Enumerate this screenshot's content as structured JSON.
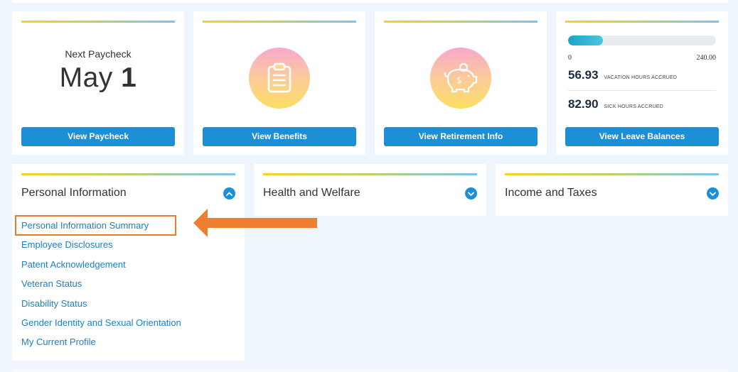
{
  "cards": {
    "paycheck": {
      "label": "Next Paycheck",
      "month": "May",
      "day": "1",
      "button": "View Paycheck"
    },
    "benefits": {
      "icon": "clipboard-icon",
      "button": "View Benefits"
    },
    "retirement": {
      "icon": "piggy-bank-icon",
      "button": "View Retirement Info"
    },
    "leave": {
      "progress_fraction": 0.236,
      "scale_min": "0",
      "scale_max": "240.00",
      "vacation_hours": "56.93",
      "vacation_label": "VACATION HOURS ACCRUED",
      "sick_hours": "82.90",
      "sick_label": "SICK HOURS ACCRUED",
      "button": "View Leave Balances"
    }
  },
  "panels": {
    "personal": {
      "title": "Personal Information",
      "links": [
        "Personal Information Summary",
        "Employee Disclosures",
        "Patent Acknowledgement",
        "Veteran Status",
        "Disability Status",
        "Gender Identity and Sexual Orientation",
        "My Current Profile"
      ]
    },
    "health": {
      "title": "Health and Welfare"
    },
    "income": {
      "title": "Income and Taxes"
    }
  },
  "colors": {
    "accent": "#1c8fd6",
    "link": "#1c7fc4",
    "highlight": "#e87a30",
    "background": "#eef5fc"
  }
}
